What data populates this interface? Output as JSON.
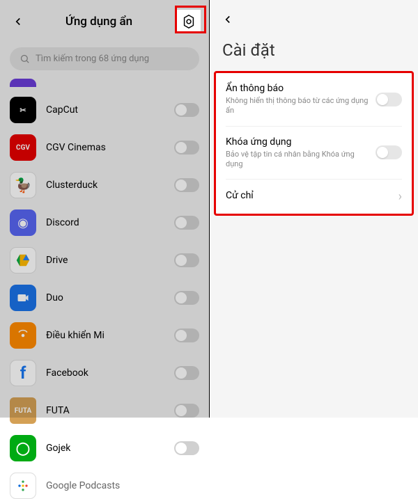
{
  "left": {
    "title": "Ứng dụng ẩn",
    "search_placeholder": "Tìm kiếm trong 68 ứng dụng",
    "apps": [
      {
        "label": "CapCut"
      },
      {
        "label": "CGV Cinemas"
      },
      {
        "label": "Clusterduck"
      },
      {
        "label": "Discord"
      },
      {
        "label": "Drive"
      },
      {
        "label": "Duo"
      },
      {
        "label": "Điều khiển Mi"
      },
      {
        "label": "Facebook"
      },
      {
        "label": "FUTA"
      },
      {
        "label": "Gojek"
      },
      {
        "label": "Google Podcasts"
      }
    ]
  },
  "right": {
    "title": "Cài đặt",
    "items": [
      {
        "title": "Ẩn thông báo",
        "desc": "Không hiển thị thông báo từ các ứng dụng ẩn"
      },
      {
        "title": "Khóa ứng dụng",
        "desc": "Bảo vệ tập tin cá nhân bằng Khóa ứng dụng"
      },
      {
        "title": "Cử chỉ"
      }
    ]
  }
}
